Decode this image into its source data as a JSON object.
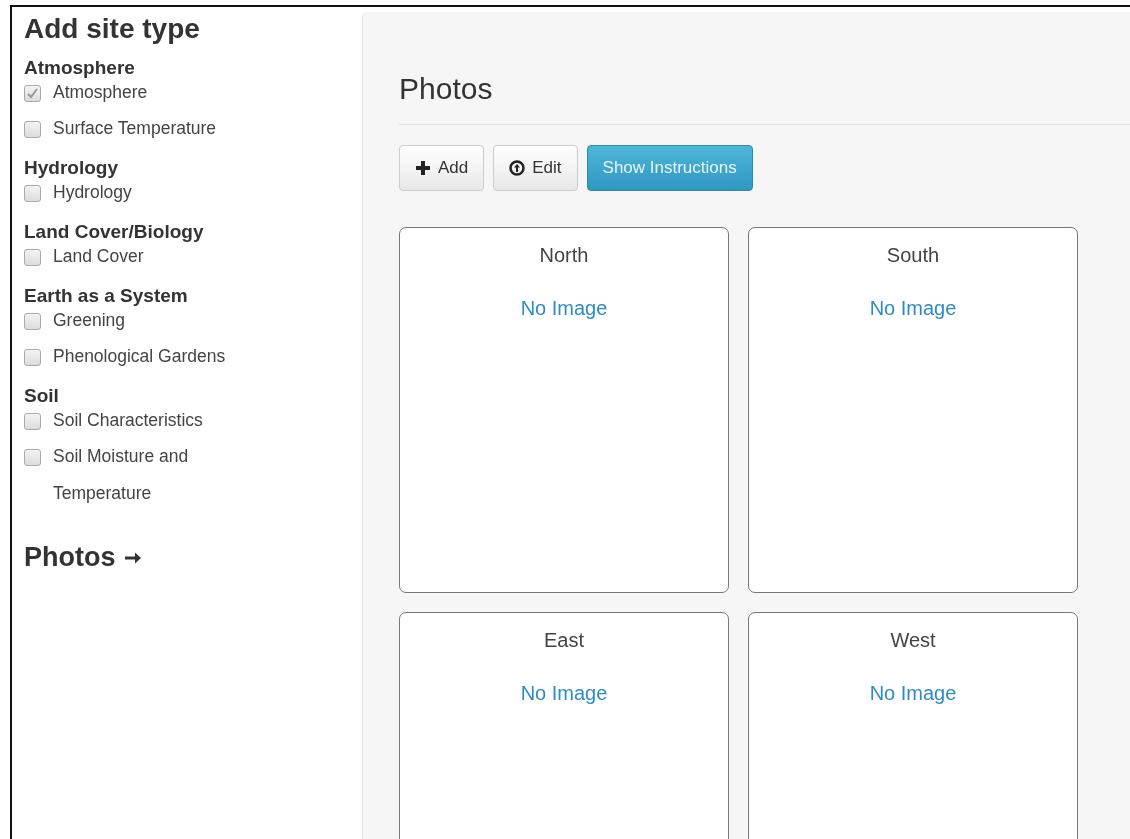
{
  "sidebar": {
    "title": "Add site type",
    "groups": [
      {
        "heading": "Atmosphere",
        "items": [
          {
            "label": "Atmosphere",
            "checked": true
          },
          {
            "label": "Surface Temperature",
            "checked": false
          }
        ]
      },
      {
        "heading": "Hydrology",
        "items": [
          {
            "label": "Hydrology",
            "checked": false
          }
        ]
      },
      {
        "heading": "Land Cover/Biology",
        "items": [
          {
            "label": "Land Cover",
            "checked": false
          }
        ]
      },
      {
        "heading": "Earth as a System",
        "items": [
          {
            "label": "Greening",
            "checked": false
          },
          {
            "label": "Phenological Gardens",
            "checked": false
          }
        ]
      },
      {
        "heading": "Soil",
        "items": [
          {
            "label": "Soil Characteristics",
            "checked": false
          },
          {
            "label": "Soil Moisture and Temperature",
            "checked": false
          }
        ]
      }
    ],
    "next_link": "Photos"
  },
  "main": {
    "title": "Photos",
    "buttons": [
      {
        "label": "Add",
        "kind": "add"
      },
      {
        "label": "Edit",
        "kind": "edit"
      },
      {
        "label": "Show Instructions",
        "kind": "primary"
      }
    ],
    "photos": [
      {
        "title": "North",
        "status": "No Image"
      },
      {
        "title": "South",
        "status": "No Image"
      },
      {
        "title": "East",
        "status": "No Image"
      },
      {
        "title": "West",
        "status": "No Image"
      }
    ]
  }
}
